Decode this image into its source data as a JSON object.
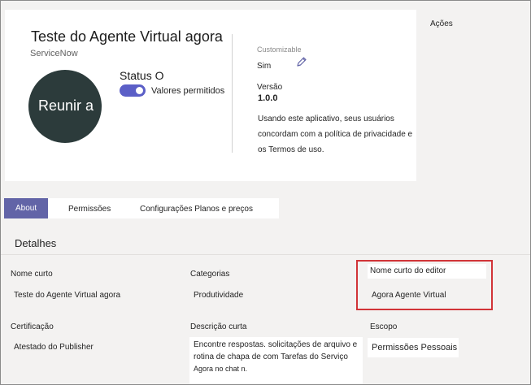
{
  "app": {
    "title": "Teste do Agente Virtual agora",
    "publisher": "ServiceNow",
    "avatar_text": "Reunir a",
    "status_label": "Status O",
    "toggle_label": "Valores permitidos",
    "customizable_label": "Customizable",
    "customizable_value": "Sim",
    "version_label": "Versão",
    "version_value": "1.0.0",
    "privacy_text": "Usando este aplicativo, seus usuários concordam com a política de privacidade e os Termos de uso."
  },
  "actions_label": "Ações",
  "tabs": [
    {
      "label": "About"
    },
    {
      "label": "Permissões"
    },
    {
      "label": "Configurações  Planos e preços"
    }
  ],
  "details": {
    "heading": "Detalhes",
    "short_name_label": "Nome curto",
    "short_name_value": "Teste do Agente Virtual agora",
    "categories_label": "Categorias",
    "categories_value": "Produtividade",
    "publisher_short_label": "Nome curto do editor",
    "publisher_short_value": "Agora Agente Virtual",
    "certification_label": "Certificação",
    "certification_value": "Atestado do Publisher",
    "short_desc_label": "Descrição curta",
    "short_desc_lines": [
      "Encontre respostas. solicitações de arquivo e",
      "rotina de chapa de com Tarefas do Serviço",
      "Agora no chat n."
    ],
    "scope_label": "Escopo",
    "scope_value": "Permissões Pessoais"
  },
  "colors": {
    "accent": "#6264a7",
    "toggle": "#5b5fc7",
    "avatar_bg": "#2c3b3b",
    "highlight_border": "#d13438",
    "page_bg": "#f3f2f1"
  },
  "icons": [
    "pencil-edit-icon"
  ]
}
